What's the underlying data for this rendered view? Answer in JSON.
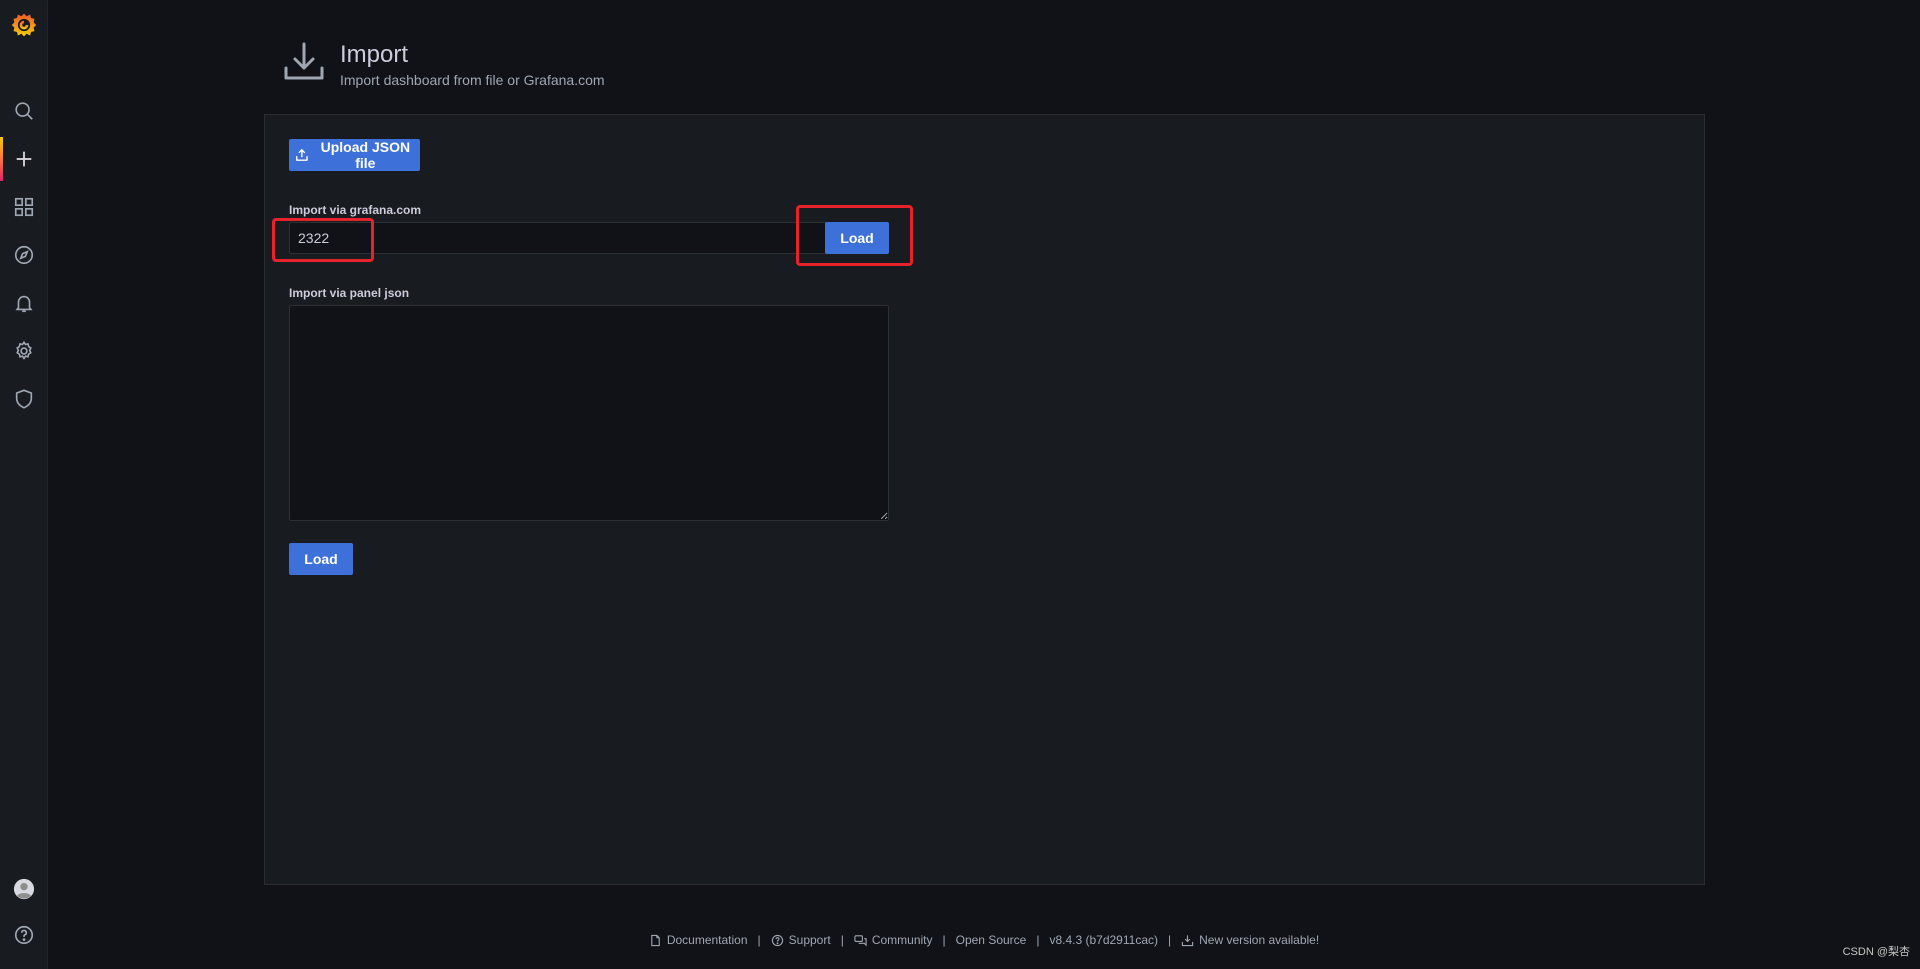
{
  "app": {
    "name": "Grafana",
    "accent": "#ff8833"
  },
  "sidebar": {
    "items": [
      {
        "name": "search",
        "icon": "search-icon"
      },
      {
        "name": "create",
        "icon": "plus-icon",
        "active": true
      },
      {
        "name": "dashboards",
        "icon": "apps-icon"
      },
      {
        "name": "explore",
        "icon": "compass-icon"
      },
      {
        "name": "alerting",
        "icon": "bell-icon"
      },
      {
        "name": "configuration",
        "icon": "cog-icon"
      },
      {
        "name": "server-admin",
        "icon": "shield-icon"
      }
    ],
    "bottom": [
      {
        "name": "profile",
        "icon": "avatar-icon"
      },
      {
        "name": "help",
        "icon": "question-circle-icon"
      }
    ]
  },
  "header": {
    "title": "Import",
    "subtitle": "Import dashboard from file or Grafana.com"
  },
  "import": {
    "upload_label": "Upload JSON file",
    "grafana_com_label": "Import via grafana.com",
    "grafana_com_value": "2322",
    "grafana_com_load_label": "Load",
    "panel_json_label": "Import via panel json",
    "panel_json_value": "",
    "panel_json_load_label": "Load"
  },
  "footer": {
    "documentation": "Documentation",
    "support": "Support",
    "community": "Community",
    "open_source": "Open Source",
    "version": "v8.4.3 (b7d2911cac)",
    "new_version": "New version available!",
    "separator": "|"
  },
  "watermark": "CSDN @梨杏",
  "colors": {
    "primary_button": "#3d71d9",
    "highlight": "#e8222a",
    "panel_bg": "#181b1f",
    "page_bg": "#111217"
  }
}
